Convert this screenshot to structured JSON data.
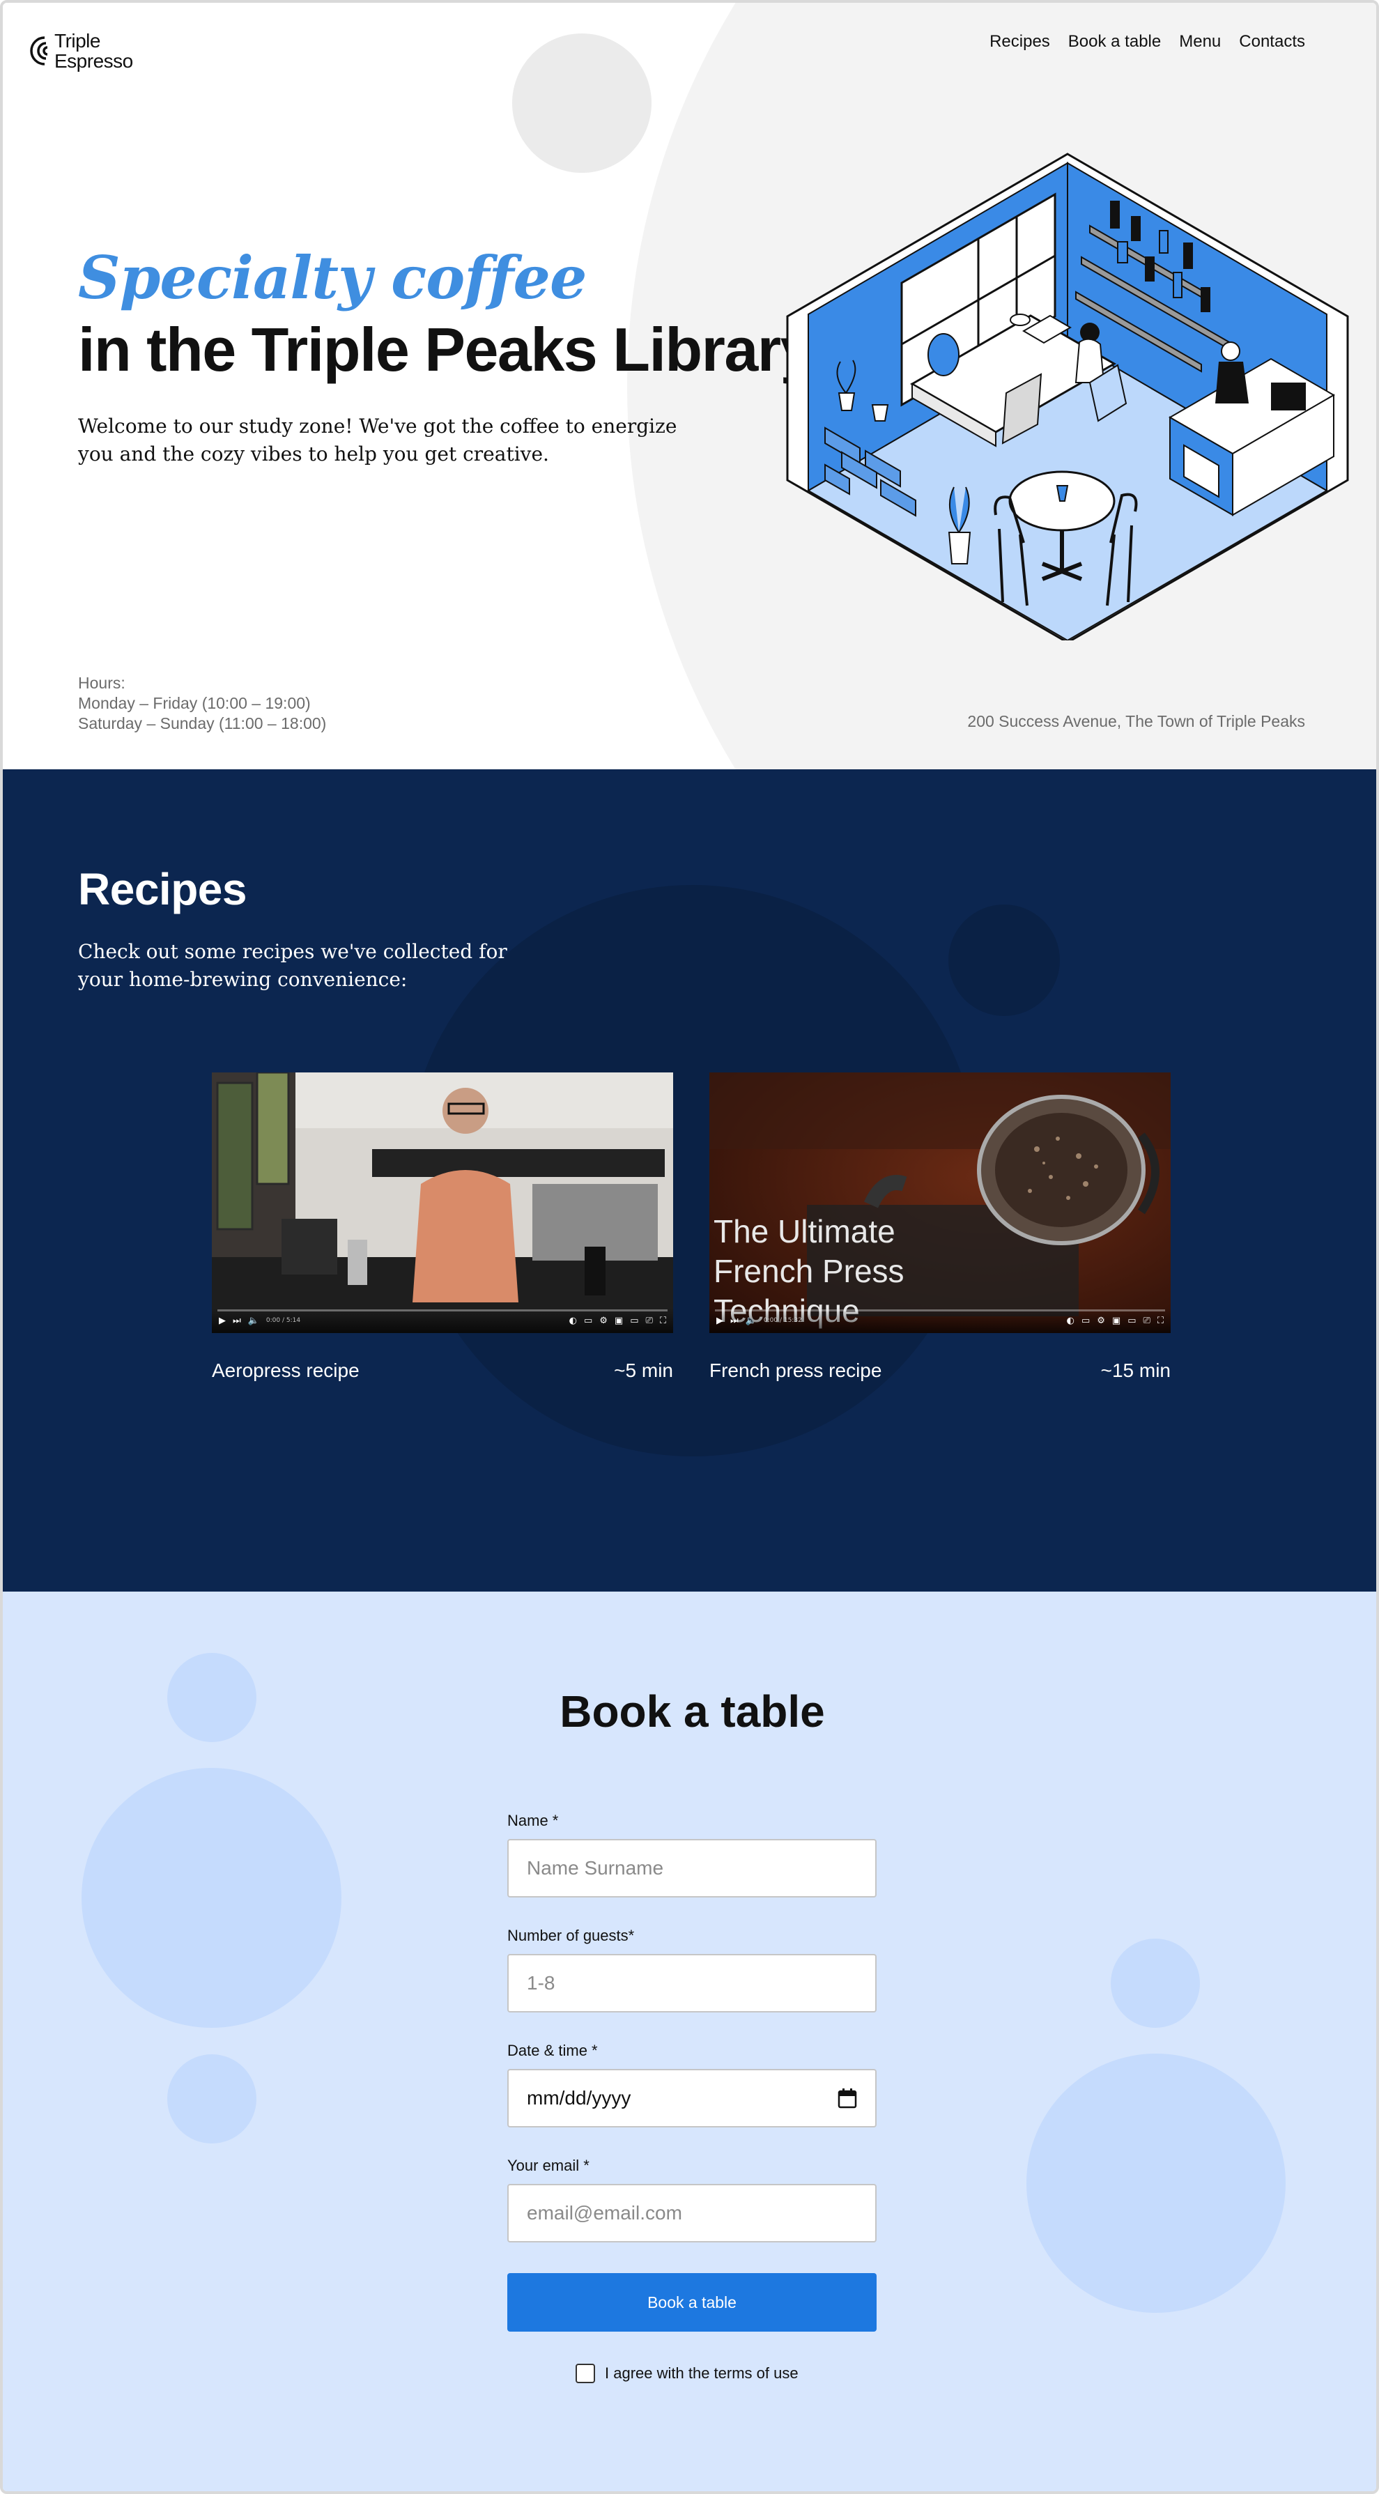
{
  "brand": {
    "name": "Triple\nEspresso",
    "accent": "#3f8ee0",
    "navy": "#0c2650",
    "light_blue": "#d7e6fd",
    "button_blue": "#1d78e0"
  },
  "nav": {
    "items": [
      "Recipes",
      "Book a table",
      "Menu",
      "Contacts"
    ]
  },
  "hero": {
    "title_italic": "Specialty coffee",
    "title": "in the Triple Peaks Library",
    "description": "Welcome to our study zone! We've got the coffee to energize you and the cozy vibes to help you get creative.",
    "hours_label": "Hours:",
    "hours_weekdays": "Monday – Friday (10:00 – 19:00)",
    "hours_weekend": "Saturday – Sunday (11:00 – 18:00)",
    "address": "200 Success Avenue, The Town of Triple Peaks"
  },
  "recipes": {
    "title": "Recipes",
    "description": "Check out some recipes we've collected for your home-brewing convenience:",
    "videos": [
      {
        "caption": "Aeropress recipe",
        "duration": "~5 min",
        "timestamp": "0:00 / 5:14"
      },
      {
        "caption": "French press recipe",
        "duration": "~15 min",
        "overlay": "The Ultimate French Press Technique",
        "timestamp": "0:00 / 15:32"
      }
    ]
  },
  "book": {
    "title": "Book a table",
    "name_label": "Name *",
    "name_placeholder": "Name Surname",
    "guests_label": "Number of guests*",
    "guests_placeholder": "1-8",
    "date_label": "Date & time *",
    "date_value": "mm/dd/yyyy",
    "email_label": "Your email *",
    "email_placeholder": "email@email.com",
    "button": "Book a table",
    "agree": "I agree with the terms of use"
  }
}
